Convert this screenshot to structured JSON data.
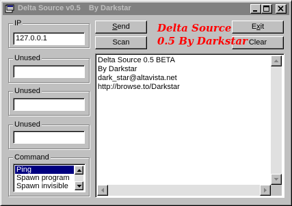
{
  "window": {
    "title": "Delta Source v0.5    By Darkstar"
  },
  "groups": {
    "ip": {
      "label": "IP",
      "value": "127.0.0.1"
    },
    "unused1": {
      "label": "Unused",
      "value": ""
    },
    "unused2": {
      "label": "Unused",
      "value": ""
    },
    "unused3": {
      "label": "Unused",
      "value": ""
    },
    "command": {
      "label": "Command",
      "options": [
        "Ping",
        "Spawn program",
        "Spawn invisible"
      ],
      "selected": "Ping"
    }
  },
  "buttons": {
    "send": {
      "label": "Send",
      "underline": "S",
      "rest": "end"
    },
    "scan": {
      "label": "Scan"
    },
    "exit": {
      "label": "Exit",
      "pre": "E",
      "underline": "x",
      "post": "it"
    },
    "clear": {
      "label": "Clear"
    }
  },
  "brand": {
    "line1": "Delta Source",
    "line2": "0.5 By Darkstar",
    "color": "#ff0000"
  },
  "output": {
    "lines": [
      "Delta Source 0.5 BETA",
      "By Darkstar",
      "dark_star@altavista.net",
      "http://browse.to/Darkstar"
    ]
  },
  "icons": {
    "app": "app-icon",
    "minimize": "minimize-icon",
    "maximize": "maximize-icon",
    "close": "close-icon"
  },
  "colors": {
    "face": "#c0c0c0",
    "titlebar_inactive": "#808080",
    "selection": "#000080",
    "brand": "#ff0000"
  }
}
